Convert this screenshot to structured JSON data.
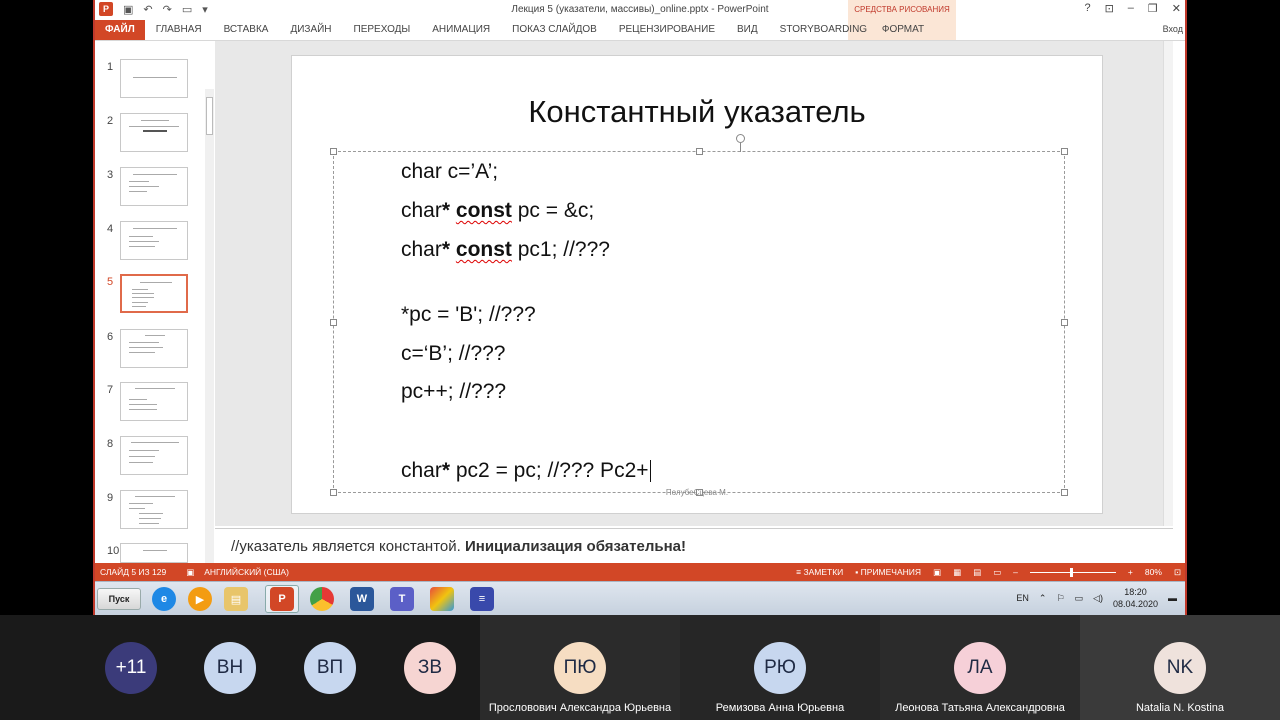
{
  "window": {
    "title": "Лекция 5 (указатели, массивы)_online.pptx - PowerPoint",
    "contextual_group": "СРЕДСТВА РИСОВАНИЯ",
    "help": "?",
    "min": "–",
    "max": "❐",
    "close": "✕",
    "sign_in": "Вход"
  },
  "ribbon": {
    "tabs": [
      "ФАЙЛ",
      "ГЛАВНАЯ",
      "ВСТАВКА",
      "ДИЗАЙН",
      "ПЕРЕХОДЫ",
      "АНИМАЦИЯ",
      "ПОКАЗ СЛАЙДОВ",
      "РЕЦЕНЗИРОВАНИЕ",
      "ВИД",
      "STORYBOARDING"
    ],
    "format_tab": "ФОРМАТ"
  },
  "thumbnails": [
    "1",
    "2",
    "3",
    "4",
    "5",
    "6",
    "7",
    "8",
    "9",
    "10"
  ],
  "slide": {
    "title": "Константный указатель",
    "line1": "char c=’A’;",
    "line2_a": "char",
    "line2_b": "*",
    "line2_c": "const",
    "line2_d": " pc = &c;",
    "line3_a": "char",
    "line3_b": "*",
    "line3_c": "const",
    "line3_d": " pc1; //???",
    "line4": "*pc = 'B'; //???",
    "line5": "c=‘B’; //???",
    "line6": "pc++;  //???",
    "line7_a": "char",
    "line7_b": "*",
    "line7_c": " pc2 = pc; //??? Pc2+",
    "footer": "ПолубеСцева М."
  },
  "notes": {
    "plain": "//указатель является константой. ",
    "bold": "Инициализация обязательна!"
  },
  "status": {
    "slide_counter": "СЛАЙД 5 ИЗ 129",
    "language": "АНГЛИЙСКИЙ (США)",
    "notes_btn": "ЗАМЕТКИ",
    "comments_btn": "ПРИМЕЧАНИЯ",
    "zoom": "80%",
    "zoom_minus": "–",
    "zoom_plus": "+"
  },
  "taskbar": {
    "start": "Пуск",
    "lang": "EN",
    "time": "18:20",
    "date": "08.04.2020"
  },
  "participants": [
    {
      "initials": "+11",
      "name": "",
      "color": "#3b3b7a"
    },
    {
      "initials": "ВН",
      "name": "",
      "color": "#c7d7ef"
    },
    {
      "initials": "ВП",
      "name": "",
      "color": "#c7d7ef"
    },
    {
      "initials": "ЗВ",
      "name": "",
      "color": "#f6d5d2"
    },
    {
      "initials": "ПЮ",
      "name": "Прословович Александра Юрьевна",
      "color": "#f6ddc2"
    },
    {
      "initials": "РЮ",
      "name": "Ремизова Анна Юрьевна",
      "color": "#c7d7ef"
    },
    {
      "initials": "ЛА",
      "name": "Леонова Татьяна Александровна",
      "color": "#f6d0d8"
    },
    {
      "initials": "NK",
      "name": "Natalia N. Kostina",
      "color": "#efe2dc"
    }
  ]
}
